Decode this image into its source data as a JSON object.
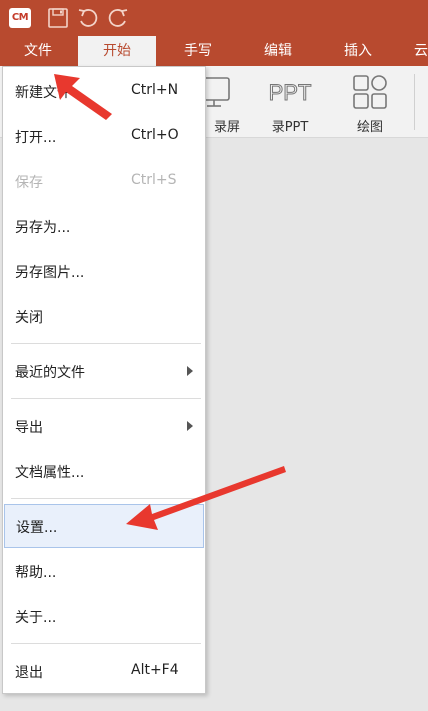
{
  "app": {
    "logo_text": "CM"
  },
  "tabs": [
    {
      "label": "文件"
    },
    {
      "label": "开始"
    },
    {
      "label": "手写"
    },
    {
      "label": "编辑"
    },
    {
      "label": "插入"
    },
    {
      "label": "云"
    }
  ],
  "ribbon": {
    "partial_label": "录屏",
    "ppt_icon_text": "PPT",
    "ppt_label": "录PPT",
    "draw_label": "绘图"
  },
  "file_menu": {
    "items": [
      {
        "label": "新建文件",
        "shortcut": "Ctrl+N"
      },
      {
        "label": "打开...",
        "shortcut": "Ctrl+O"
      },
      {
        "label": "保存",
        "shortcut": "Ctrl+S",
        "disabled": true
      },
      {
        "label": "另存为...",
        "shortcut": ""
      },
      {
        "label": "另存图片...",
        "shortcut": ""
      },
      {
        "label": "关闭",
        "shortcut": ""
      },
      {
        "label": "最近的文件",
        "submenu": true
      },
      {
        "label": "导出",
        "submenu": true
      },
      {
        "label": "文档属性...",
        "shortcut": ""
      },
      {
        "label": "设置...",
        "hovered": true
      },
      {
        "label": "帮助...",
        "shortcut": ""
      },
      {
        "label": "关于...",
        "shortcut": ""
      },
      {
        "label": "退出",
        "shortcut": "Alt+F4"
      }
    ]
  },
  "colors": {
    "titlebar": "#b84a2f",
    "annotation_arrow": "#e8382e"
  }
}
